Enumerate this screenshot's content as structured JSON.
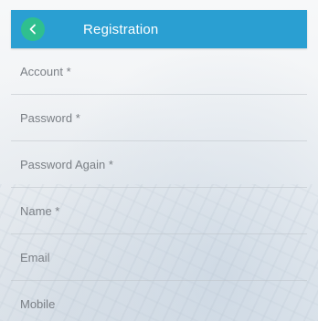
{
  "header": {
    "title": "Registration",
    "back_icon": "back-arrow-icon",
    "color": "#2a9fd2",
    "back_color": "#2fbf8f"
  },
  "form": {
    "fields": [
      {
        "label": "Account *"
      },
      {
        "label": "Password *"
      },
      {
        "label": "Password Again *"
      },
      {
        "label": "Name *"
      },
      {
        "label": "Email"
      },
      {
        "label": "Mobile"
      }
    ]
  }
}
